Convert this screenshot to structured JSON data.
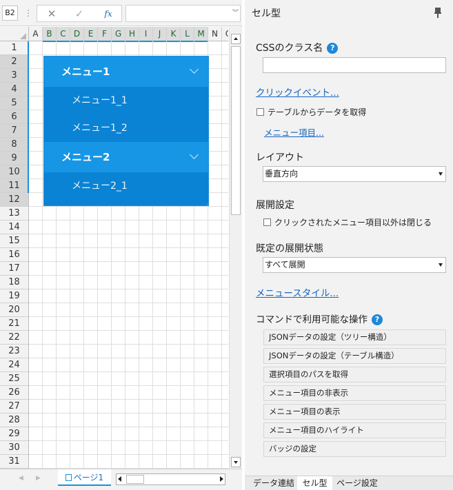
{
  "formula_bar": {
    "name_box": "B2",
    "separator": "⋮",
    "cancel_glyph": "✕",
    "confirm_glyph": "✓",
    "function_glyph": "fx",
    "expand_glyph": "︾"
  },
  "sheet": {
    "columns": [
      "A",
      "B",
      "C",
      "D",
      "E",
      "F",
      "G",
      "H",
      "I",
      "J",
      "K",
      "L",
      "M",
      "N",
      "O"
    ],
    "selected_columns": [
      "B",
      "C",
      "D",
      "E",
      "F",
      "G",
      "H",
      "I",
      "J",
      "K",
      "L",
      "M"
    ],
    "rows": [
      "1",
      "2",
      "3",
      "4",
      "5",
      "6",
      "7",
      "8",
      "9",
      "10",
      "11",
      "12",
      "13",
      "14",
      "15",
      "16",
      "17",
      "18",
      "19",
      "20",
      "21",
      "22",
      "23",
      "24",
      "25",
      "26",
      "27",
      "28",
      "29",
      "30",
      "31"
    ],
    "selected_rows": [
      "2",
      "3",
      "4",
      "5",
      "6",
      "7",
      "8",
      "9",
      "10",
      "11",
      "12"
    ],
    "menu": {
      "item1": "メニュー1",
      "item1_sub1": "メニュー1_1",
      "item1_sub2": "メニュー1_2",
      "item2": "メニュー2",
      "item2_sub1": "メニュー2_1"
    },
    "sheet_tab": "ページ1"
  },
  "panel": {
    "title": "セル型",
    "css_class_label": "CSSのクラス名",
    "help_glyph": "?",
    "click_event_link": "クリックイベント...",
    "table_data_checkbox": "テーブルからデータを取得",
    "menu_items_link": "メニュー項目...",
    "layout_label": "レイアウト",
    "layout_value": "垂直方向",
    "expand_settings_label": "展開設定",
    "close_others_checkbox": "クリックされたメニュー項目以外は閉じる",
    "default_state_label": "既定の展開状態",
    "default_state_value": "すべて展開",
    "menu_style_link": "メニュースタイル...",
    "commands_label": "コマンドで利用可能な操作",
    "commands": [
      "JSONデータの設定（ツリー構造）",
      "JSONデータの設定（テーブル構造）",
      "選択項目のパスを取得",
      "メニュー項目の非表示",
      "メニュー項目の表示",
      "メニュー項目のハイライト",
      "バッジの設定"
    ],
    "tabs": [
      "データ連結",
      "セル型",
      "ページ設定"
    ],
    "active_tab": "セル型"
  }
}
